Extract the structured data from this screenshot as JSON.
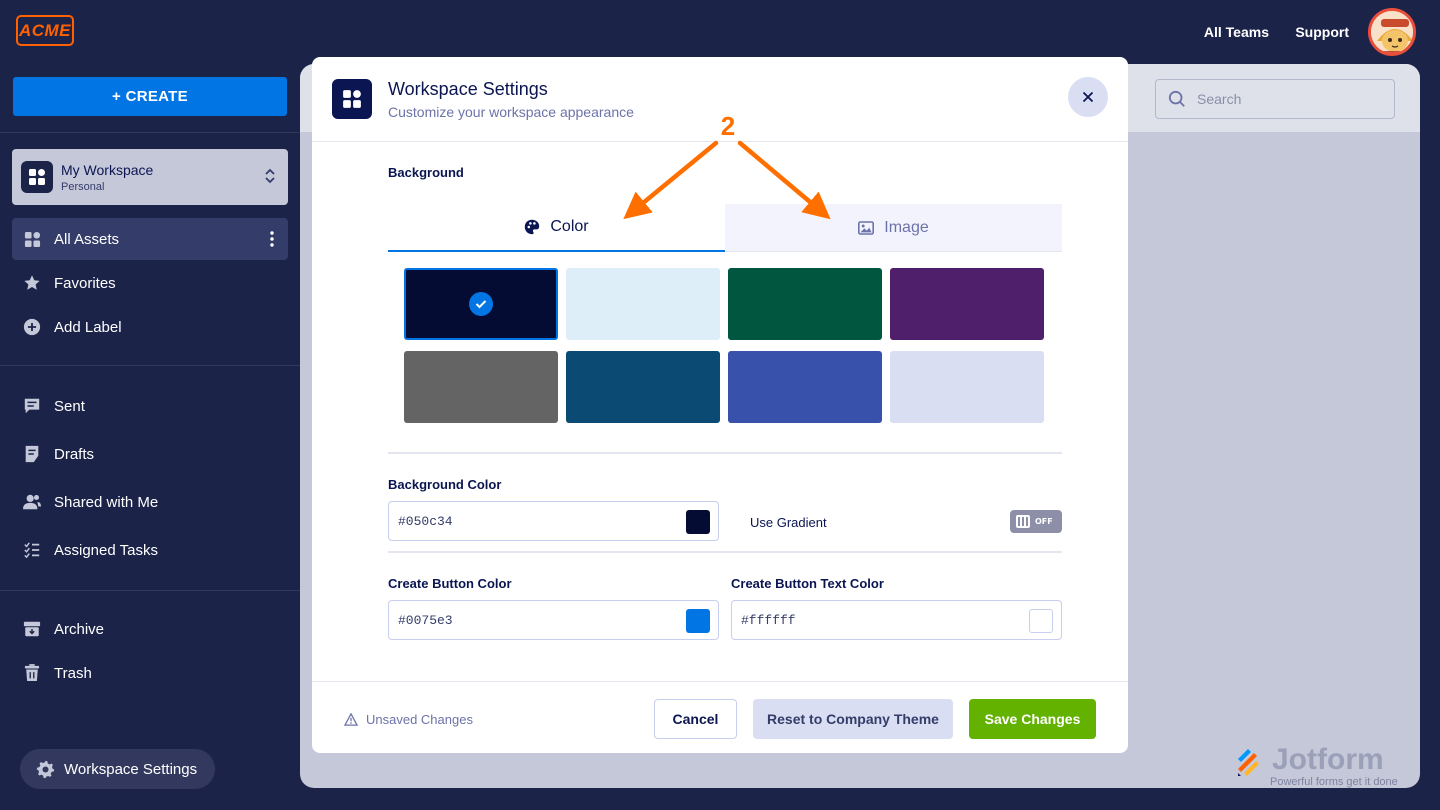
{
  "brand": {
    "logo_text": "ACME",
    "accent": "#ff6100"
  },
  "topnav": {
    "teams_label": "All Teams",
    "support_label": "Support",
    "avatar": "user-avatar"
  },
  "sidebar": {
    "create_label": "+ CREATE",
    "create_color": "#0075e3",
    "workspace": {
      "name": "My Workspace",
      "type": "Personal"
    },
    "items": [
      {
        "label": "All Assets",
        "icon": "grid-icon",
        "active": true
      },
      {
        "label": "Favorites",
        "icon": "star-icon"
      },
      {
        "label": "Add Label",
        "icon": "plus-circle-icon"
      },
      {
        "label": "Sent",
        "icon": "message-icon"
      },
      {
        "label": "Drafts",
        "icon": "draft-icon"
      },
      {
        "label": "Shared with Me",
        "icon": "users-icon"
      },
      {
        "label": "Assigned Tasks",
        "icon": "tasks-icon"
      },
      {
        "label": "Archive",
        "icon": "archive-icon"
      },
      {
        "label": "Trash",
        "icon": "trash-icon"
      }
    ],
    "settings_label": "Workspace Settings"
  },
  "search": {
    "placeholder": "Search"
  },
  "jotform": {
    "name": "Jotform",
    "tagline": "Powerful forms get it done"
  },
  "modal": {
    "title": "Workspace Settings",
    "subtitle": "Customize your workspace appearance",
    "background_label": "Background",
    "tabs": [
      {
        "label": "Color",
        "icon": "palette-icon",
        "active": true
      },
      {
        "label": "Image",
        "icon": "image-icon",
        "active": false
      }
    ],
    "swatches": [
      "#050c34",
      "#ddeef8",
      "#00563f",
      "#4f1f6b",
      "#646464",
      "#0b4b73",
      "#3852ab",
      "#dadef3"
    ],
    "selected_swatch": 0,
    "background_color_label": "Background Color",
    "background_color_value": "#050c34",
    "use_gradient_label": "Use Gradient",
    "gradient_toggle": "OFF",
    "create_button_color_label": "Create Button Color",
    "create_button_color_value": "#0075e3",
    "create_button_text_color_label": "Create Button Text Color",
    "create_button_text_color_value": "#ffffff",
    "unsaved_label": "Unsaved Changes",
    "cancel_label": "Cancel",
    "reset_label": "Reset to Company Theme",
    "save_label": "Save Changes"
  },
  "annotation": {
    "step_number": "2",
    "color": "#ff6f00"
  }
}
